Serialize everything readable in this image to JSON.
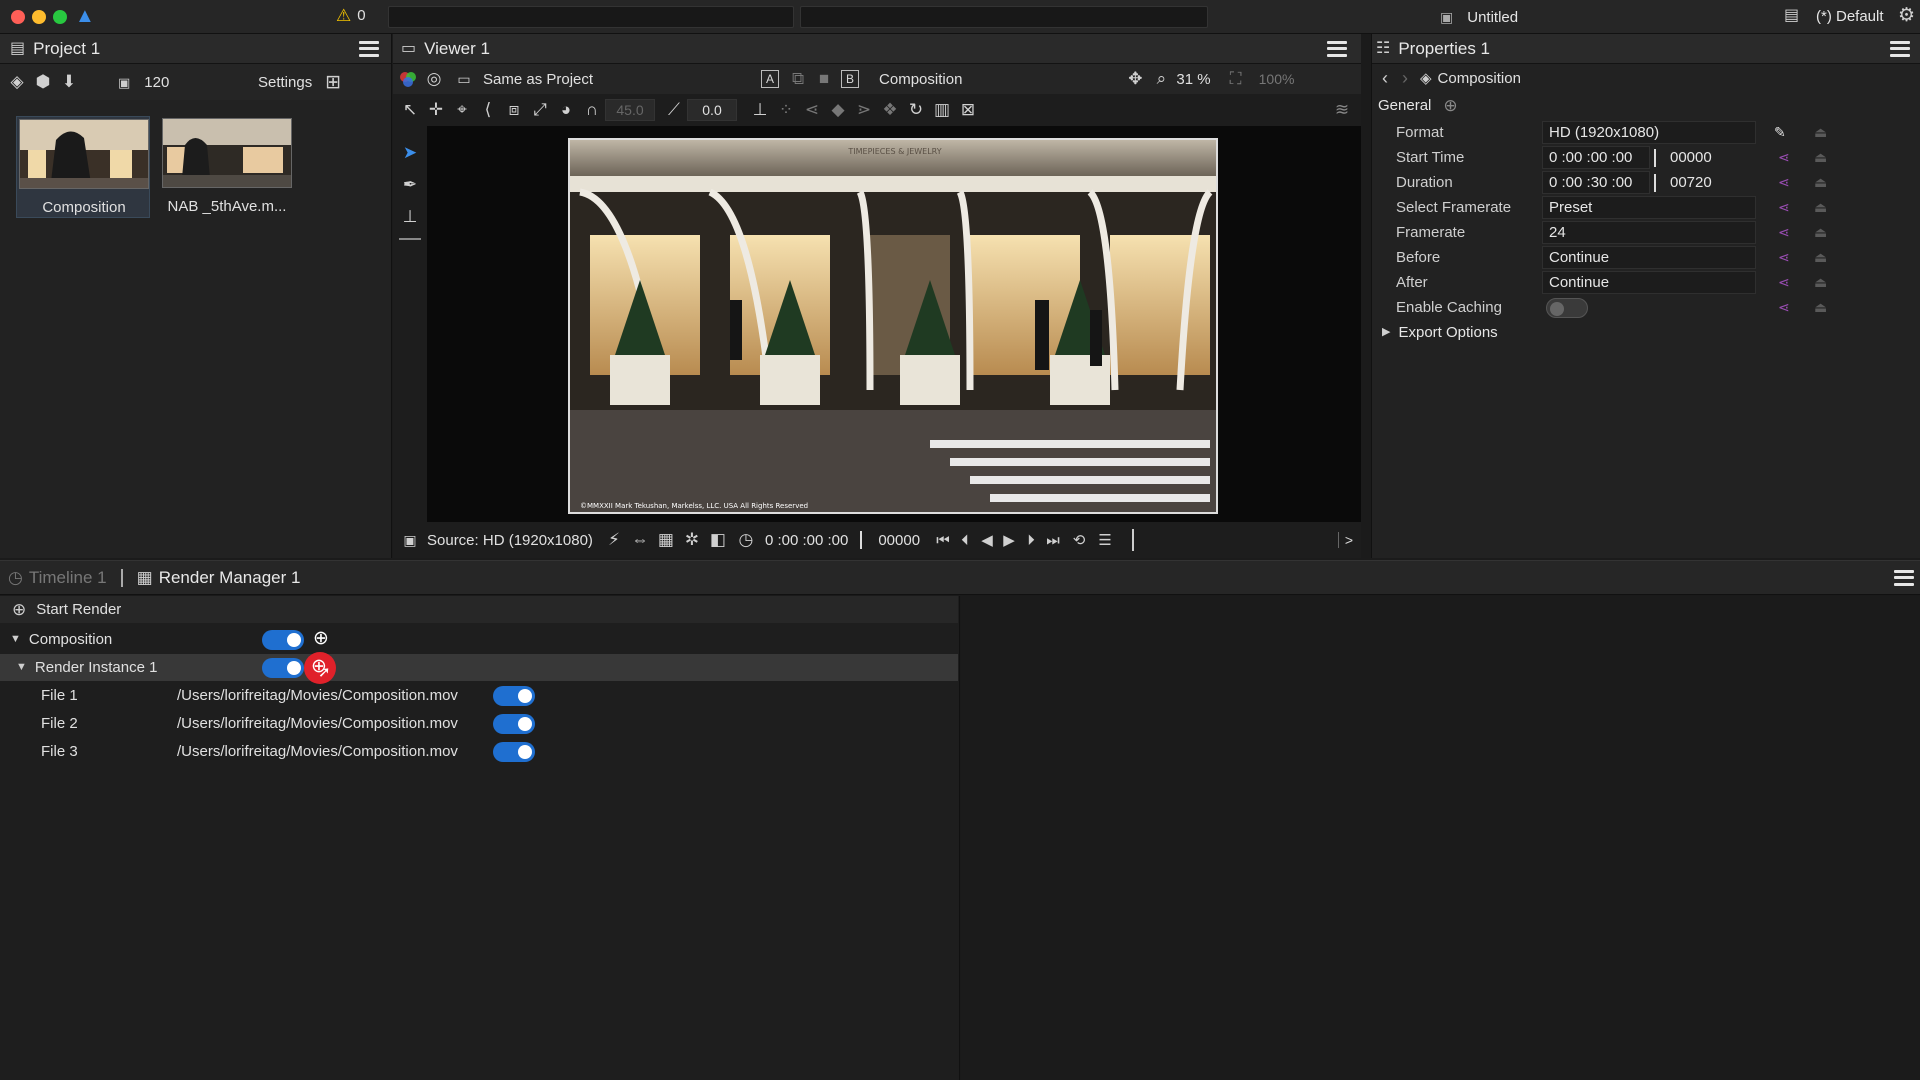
{
  "titlebar": {
    "warning_count": "0",
    "document_title": "Untitled",
    "workspace": "(*) Default"
  },
  "project": {
    "title": "Project 1",
    "frame_value": "120",
    "settings_label": "Settings",
    "items": [
      {
        "label": "Composition"
      },
      {
        "label": "NAB _5thAve.m..."
      }
    ]
  },
  "viewer": {
    "title": "Viewer 1",
    "color_space": "Same as Project",
    "a_label": "A",
    "b_label": "B",
    "b_source": "Composition",
    "zoom": "31 %",
    "zoom_full": "100%",
    "angle_value": "45.0",
    "offset_value": "0.0",
    "image_caption": "TIMEPIECES & JEWELRY",
    "copyright": "©MMXXII Mark Tekushan, Markelss, LLC. USA All Rights Reserved",
    "source_label": "Source: HD (1920x1080)",
    "timecode": "0 :00 :00 :00",
    "frame": "00000",
    "expand": ">"
  },
  "properties": {
    "title": "Properties 1",
    "breadcrumb": "Composition",
    "section": "General",
    "rows": [
      {
        "label": "Format",
        "value": "HD (1920x1080)"
      },
      {
        "label": "Start Time",
        "value": "0 :00 :00 :00",
        "frames": "00000"
      },
      {
        "label": "Duration",
        "value": "0 :00 :30 :00",
        "frames": "00720"
      },
      {
        "label": "Select Framerate",
        "value": "Preset"
      },
      {
        "label": "Framerate",
        "value": "24"
      },
      {
        "label": "Before",
        "value": "Continue"
      },
      {
        "label": "After",
        "value": "Continue"
      },
      {
        "label": "Enable Caching",
        "value": ""
      }
    ],
    "export_options": "Export Options"
  },
  "bottom_tabs": {
    "timeline": "Timeline 1",
    "render_manager": "Render Manager 1"
  },
  "render_manager": {
    "start_render": "Start Render",
    "composition": "Composition",
    "render_instance": "Render Instance 1",
    "files": [
      {
        "label": "File 1",
        "path": "/Users/lorifreitag/Movies/Composition.mov"
      },
      {
        "label": "File 2",
        "path": "/Users/lorifreitag/Movies/Composition.mov"
      },
      {
        "label": "File 3",
        "path": "/Users/lorifreitag/Movies/Composition.mov"
      }
    ]
  },
  "colors": {
    "accent": "#1f6fd0",
    "highlight_cursor": "#e0212a",
    "warning": "#f2c200"
  }
}
